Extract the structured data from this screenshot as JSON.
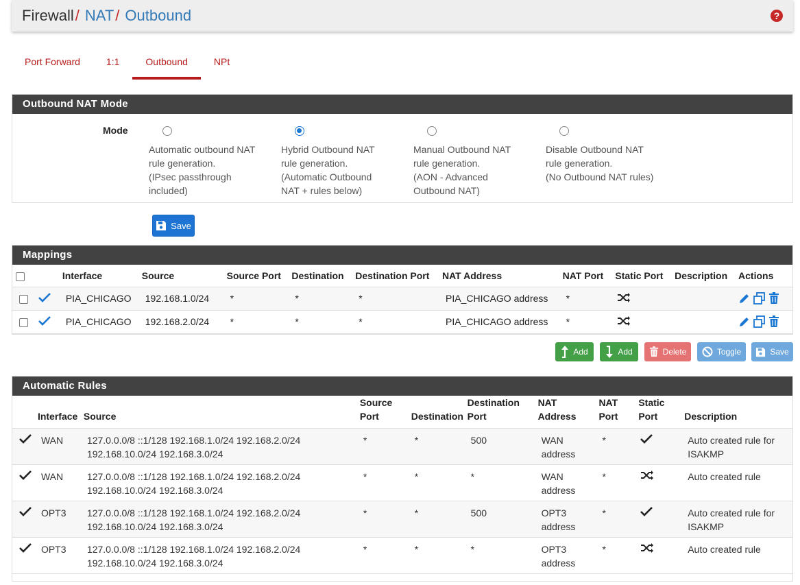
{
  "breadcrumb": {
    "first": "Firewall",
    "second": "NAT",
    "third": "Outbound",
    "sep": "/"
  },
  "help_icon": "question-circle-icon",
  "tabs": [
    {
      "label": "Port Forward"
    },
    {
      "label": "1:1"
    },
    {
      "label": "Outbound",
      "active": true
    },
    {
      "label": "NPt"
    }
  ],
  "mode_panel": {
    "title": "Outbound NAT Mode",
    "mode_label": "Mode",
    "options": [
      {
        "line1": "Automatic outbound NAT",
        "line2": "rule generation.",
        "line3": "(IPsec passthrough",
        "line4": "included)",
        "checked": false
      },
      {
        "line1": "Hybrid Outbound NAT",
        "line2": "rule generation.",
        "line3": "(Automatic Outbound",
        "line4": "NAT + rules below)",
        "checked": true
      },
      {
        "line1": "Manual Outbound NAT",
        "line2": "rule generation.",
        "line3": "(AON - Advanced",
        "line4": "Outbound NAT)",
        "checked": false
      },
      {
        "line1": "Disable Outbound NAT",
        "line2": "rule generation.",
        "line3": "(No Outbound NAT rules)",
        "line4": "",
        "checked": false
      }
    ],
    "save_label": "Save"
  },
  "mappings": {
    "title": "Mappings",
    "headers": {
      "interface": "Interface",
      "source": "Source",
      "source_port": "Source Port",
      "destination": "Destination",
      "destination_port": "Destination Port",
      "nat_address": "NAT Address",
      "nat_port": "NAT Port",
      "static_port": "Static Port",
      "description": "Description",
      "actions": "Actions"
    },
    "rows": [
      {
        "interface": "PIA_CHICAGO",
        "source": "192.168.1.0/24",
        "source_port": "*",
        "destination": "*",
        "destination_port": "*",
        "nat_address": "PIA_CHICAGO address",
        "nat_port": "*",
        "description": ""
      },
      {
        "interface": "PIA_CHICAGO",
        "source": "192.168.2.0/24",
        "source_port": "*",
        "destination": "*",
        "destination_port": "*",
        "nat_address": "PIA_CHICAGO address",
        "nat_port": "*",
        "description": ""
      }
    ],
    "buttons": {
      "add_top": "Add",
      "add_bottom": "Add",
      "delete": "Delete",
      "toggle": "Toggle",
      "save": "Save"
    }
  },
  "auto_rules": {
    "title": "Automatic Rules",
    "headers": {
      "interface": "Interface",
      "source": "Source",
      "source_port_1": "Source",
      "source_port_2": "Port",
      "destination": "Destination",
      "destination_port_1": "Destination",
      "destination_port_2": "Port",
      "nat_address_1": "NAT",
      "nat_address_2": "Address",
      "nat_port_1": "NAT",
      "nat_port_2": "Port",
      "static_port_1": "Static",
      "static_port_2": "Port",
      "description": "Description"
    },
    "rows": [
      {
        "interface": "WAN",
        "source_1": "127.0.0.0/8 ::1/128 192.168.1.0/24 192.168.2.0/24",
        "source_2": "192.168.10.0/24 192.168.3.0/24",
        "source_port": "*",
        "destination": "*",
        "destination_port": "500",
        "nat_1": "WAN",
        "nat_2": "address",
        "nat_port": "*",
        "static": "check",
        "desc_1": "Auto created rule for",
        "desc_2": "ISAKMP"
      },
      {
        "interface": "WAN",
        "source_1": "127.0.0.0/8 ::1/128 192.168.1.0/24 192.168.2.0/24",
        "source_2": "192.168.10.0/24 192.168.3.0/24",
        "source_port": "*",
        "destination": "*",
        "destination_port": "*",
        "nat_1": "WAN",
        "nat_2": "address",
        "nat_port": "*",
        "static": "random",
        "desc_1": "Auto created rule",
        "desc_2": ""
      },
      {
        "interface": "OPT3",
        "source_1": "127.0.0.0/8 ::1/128 192.168.1.0/24 192.168.2.0/24",
        "source_2": "192.168.10.0/24 192.168.3.0/24",
        "source_port": "*",
        "destination": "*",
        "destination_port": "500",
        "nat_1": "OPT3",
        "nat_2": "address",
        "nat_port": "*",
        "static": "check",
        "desc_1": "Auto created rule for",
        "desc_2": "ISAKMP"
      },
      {
        "interface": "OPT3",
        "source_1": "127.0.0.0/8 ::1/128 192.168.1.0/24 192.168.2.0/24",
        "source_2": "192.168.10.0/24 192.168.3.0/24",
        "source_port": "*",
        "destination": "*",
        "destination_port": "*",
        "nat_1": "OPT3",
        "nat_2": "address",
        "nat_port": "*",
        "static": "random",
        "desc_1": "Auto created rule",
        "desc_2": ""
      }
    ]
  }
}
